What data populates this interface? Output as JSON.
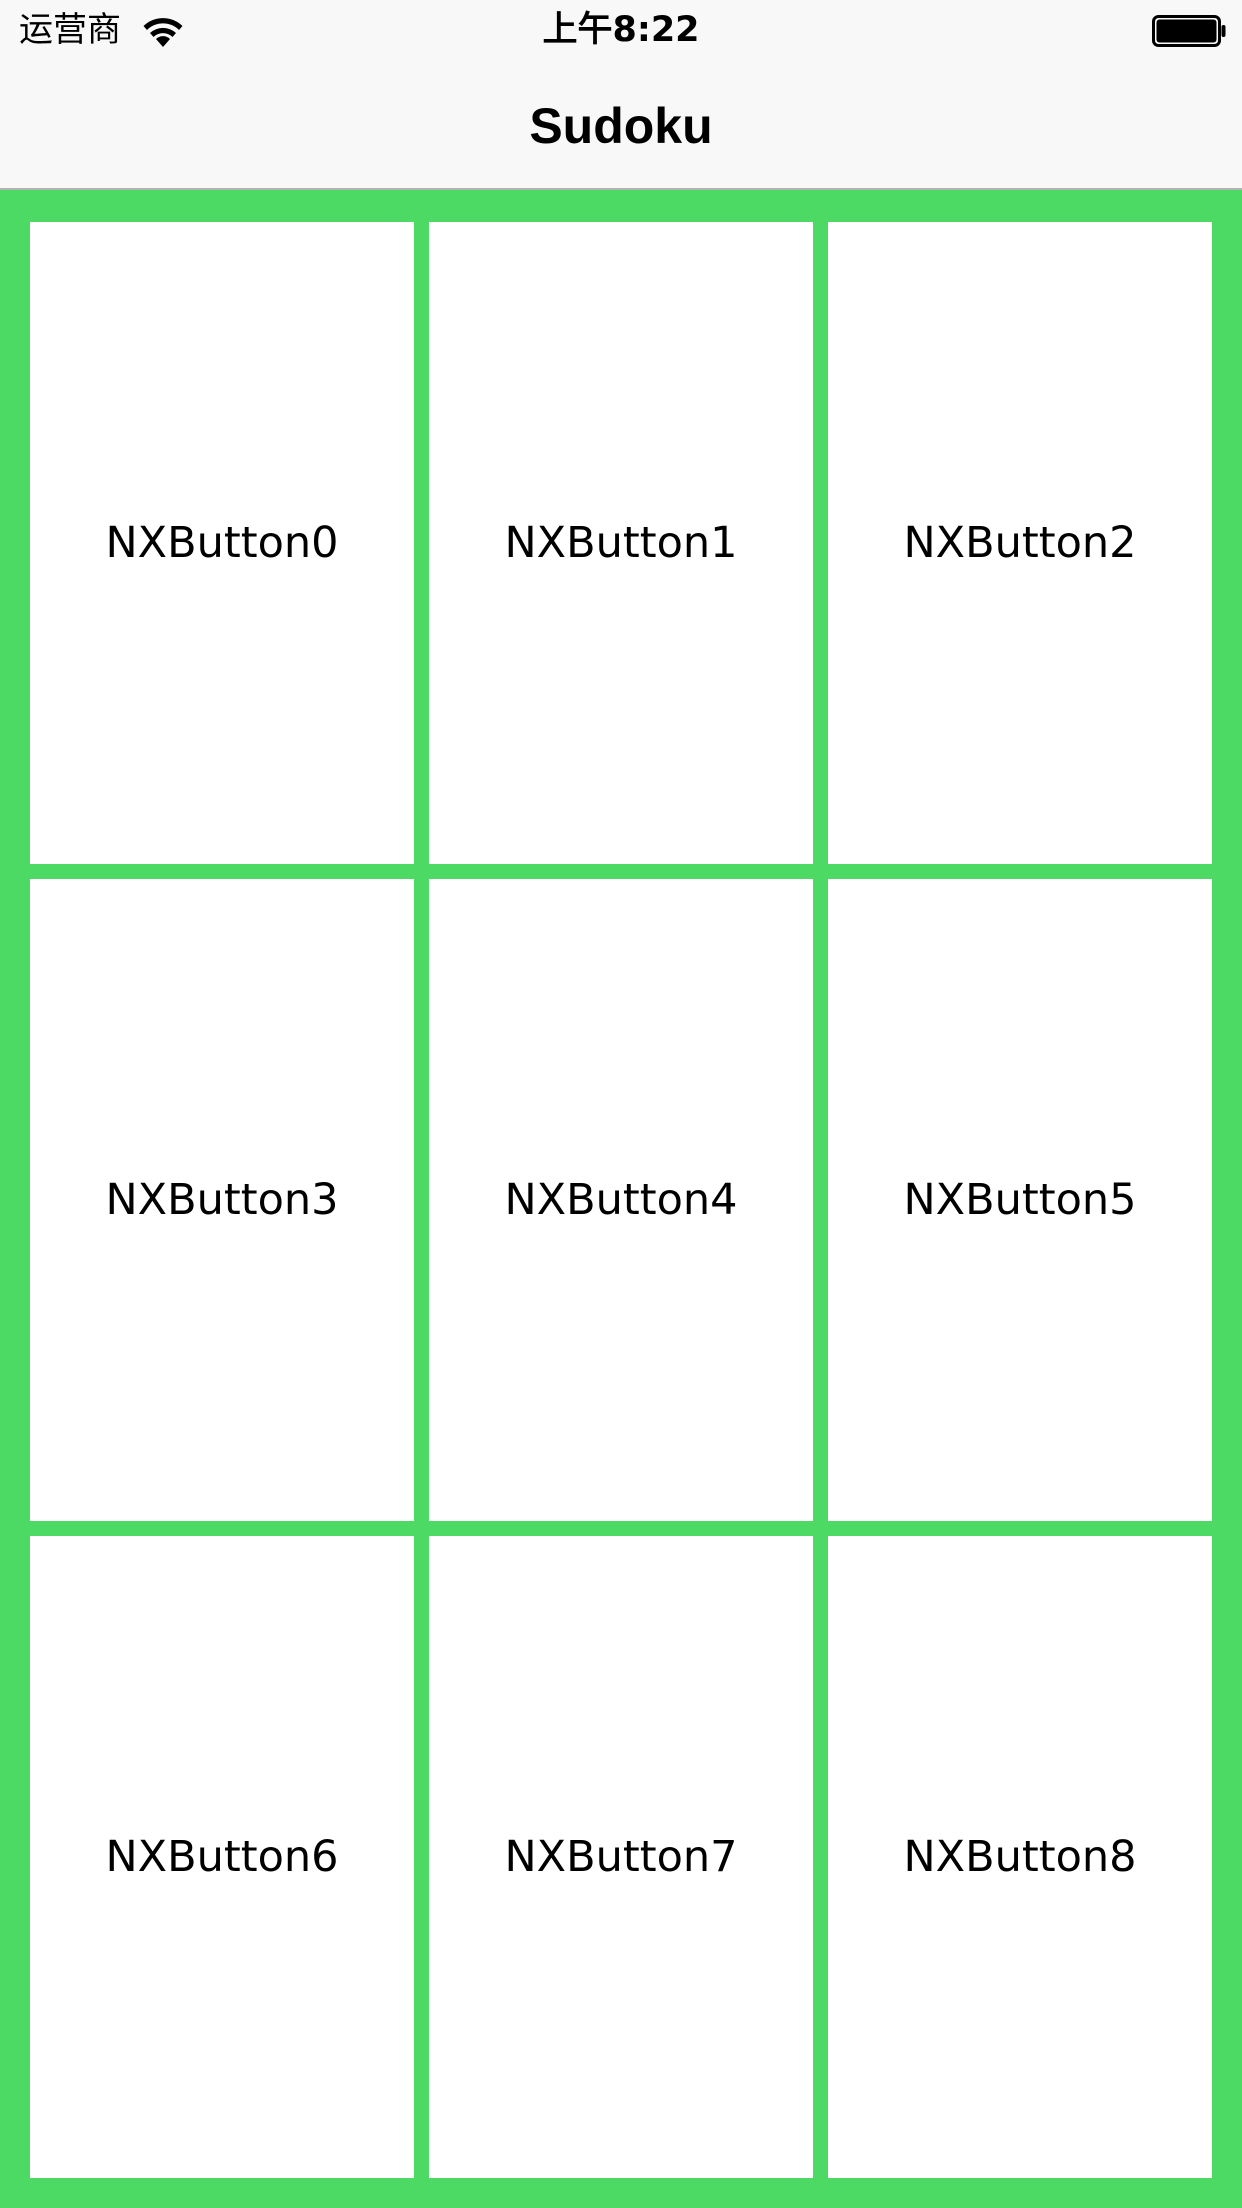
{
  "status_bar": {
    "carrier": "运营商",
    "time": "上午8:22",
    "wifi_icon": "wifi-icon",
    "battery_icon": "battery-icon"
  },
  "nav": {
    "title": "Sudoku"
  },
  "grid": {
    "background_color": "#4cd964",
    "cell_color": "#ffffff",
    "buttons": [
      {
        "label": "NXButton0"
      },
      {
        "label": "NXButton1"
      },
      {
        "label": "NXButton2"
      },
      {
        "label": "NXButton3"
      },
      {
        "label": "NXButton4"
      },
      {
        "label": "NXButton5"
      },
      {
        "label": "NXButton6"
      },
      {
        "label": "NXButton7"
      },
      {
        "label": "NXButton8"
      }
    ]
  }
}
